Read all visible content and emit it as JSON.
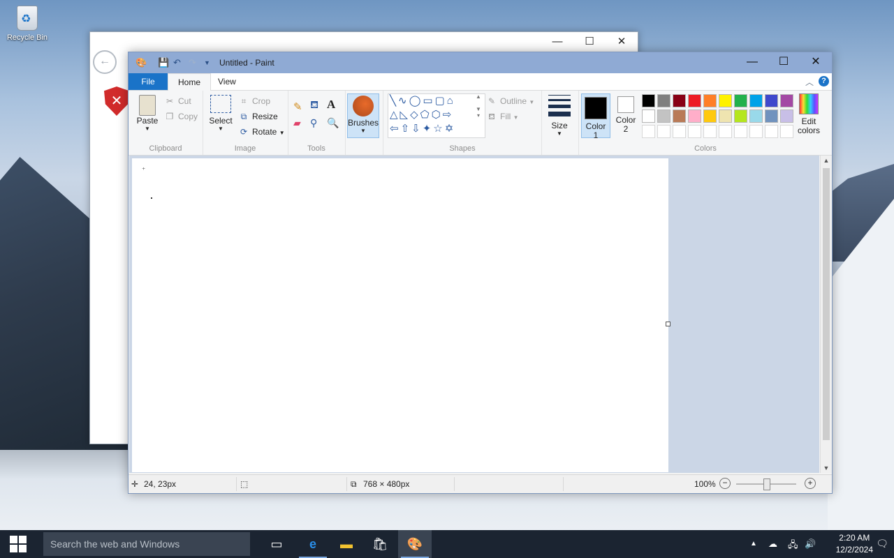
{
  "desktop": {
    "recycle_bin_label": "Recycle Bin"
  },
  "back_window": {
    "minimize": "—",
    "maximize": "☐",
    "close": "✕"
  },
  "paint": {
    "title": "Untitled - Paint",
    "window_controls": {
      "minimize": "—",
      "maximize": "☐",
      "close": "✕"
    },
    "tabs": {
      "file": "File",
      "home": "Home",
      "view": "View"
    },
    "ribbon": {
      "clipboard": {
        "paste": "Paste",
        "cut": "Cut",
        "copy": "Copy",
        "label": "Clipboard"
      },
      "image": {
        "select": "Select",
        "crop": "Crop",
        "resize": "Resize",
        "rotate": "Rotate",
        "label": "Image"
      },
      "tools": {
        "label": "Tools"
      },
      "brushes": {
        "label": "Brushes"
      },
      "shapes": {
        "outline": "Outline",
        "fill": "Fill",
        "label": "Shapes"
      },
      "size": {
        "label": "Size"
      },
      "colors": {
        "color1": "Color\n1",
        "color1_value": "#000000",
        "color2": "Color\n2",
        "color2_value": "#ffffff",
        "edit_colors": "Edit\ncolors",
        "label": "Colors",
        "palette_row1": [
          "#000000",
          "#7f7f7f",
          "#880015",
          "#ed1c24",
          "#ff7f27",
          "#fff200",
          "#22b14c",
          "#00a2e8",
          "#3f48cc",
          "#a349a4"
        ],
        "palette_row2": [
          "#ffffff",
          "#c3c3c3",
          "#b97a57",
          "#ffaec9",
          "#ffc90e",
          "#efe4b0",
          "#b5e61d",
          "#99d9ea",
          "#7092be",
          "#c8bfe7"
        ],
        "palette_row3": [
          "#ffffff",
          "#ffffff",
          "#ffffff",
          "#ffffff",
          "#ffffff",
          "#ffffff",
          "#ffffff",
          "#ffffff",
          "#ffffff",
          "#ffffff"
        ]
      }
    },
    "status": {
      "cursor_pos": "24, 23px",
      "canvas_size": "768 × 480px",
      "zoom": "100%",
      "zoom_level": 0.5
    }
  },
  "taskbar": {
    "search_placeholder": "Search the web and Windows",
    "time": "2:20 AM",
    "date": "12/2/2024"
  }
}
